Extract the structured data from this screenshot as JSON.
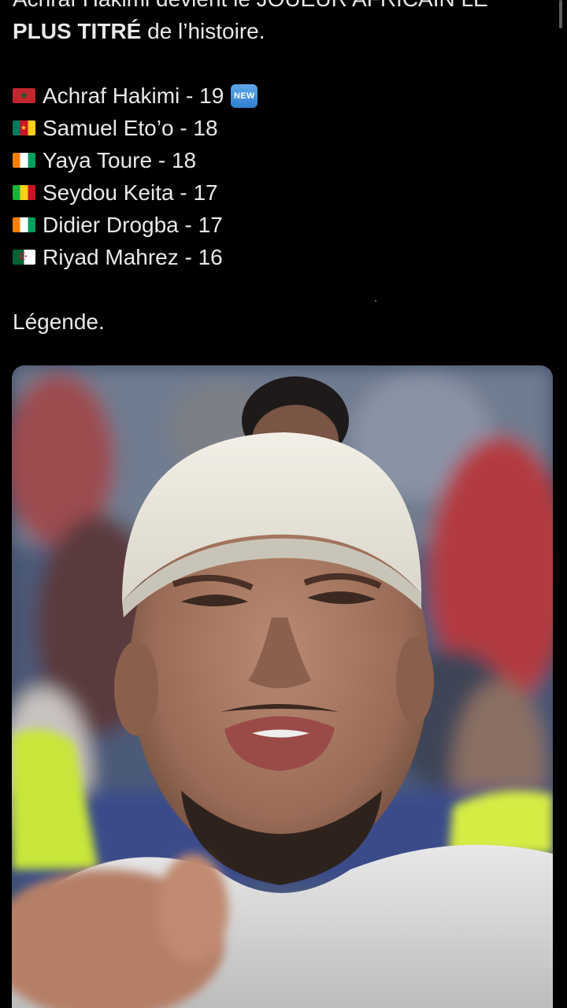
{
  "tweet": {
    "top_line": "Achraf Hakimi devient le JOUEUR AFRICAIN LE",
    "second_line_bold": "PLUS TITRÉ",
    "second_line_rest": " de l’histoire.",
    "ranking": [
      {
        "flag": "morocco-flag-icon",
        "text": "Achraf Hakimi - 19",
        "badge": "NEW"
      },
      {
        "flag": "cameroon-flag-icon",
        "text": "Samuel Eto’o - 18"
      },
      {
        "flag": "ivory-coast-flag-icon",
        "text": "Yaya Toure - 18"
      },
      {
        "flag": "mali-flag-icon",
        "text": "Seydou Keita - 17"
      },
      {
        "flag": "ivory-coast-flag-icon",
        "text": "Didier Drogba - 17"
      },
      {
        "flag": "algeria-flag-icon",
        "text": "Riyad Mahrez - 16"
      }
    ],
    "closing": "Légende."
  },
  "colors": {
    "background": "#000000",
    "text": "#e7e9ea",
    "new_badge": "#3b8ad8"
  }
}
